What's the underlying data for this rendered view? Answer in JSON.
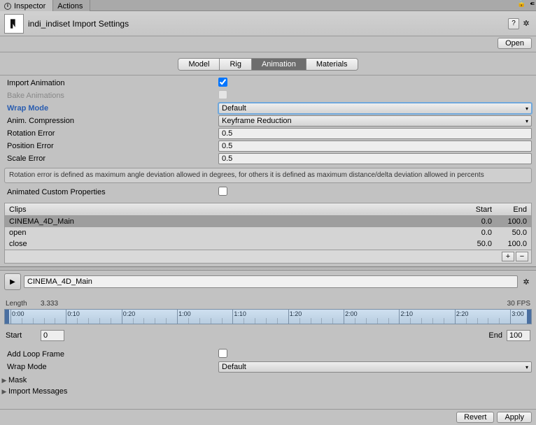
{
  "top": {
    "inspector": "Inspector",
    "actions": "Actions"
  },
  "asset": {
    "title": "indi_indiset Import Settings",
    "open": "Open"
  },
  "tabs": {
    "model": "Model",
    "rig": "Rig",
    "animation": "Animation",
    "materials": "Materials"
  },
  "labels": {
    "importAnim": "Import Animation",
    "bakeAnim": "Bake Animations",
    "wrapMode": "Wrap Mode",
    "animComp": "Anim. Compression",
    "rotErr": "Rotation Error",
    "posErr": "Position Error",
    "scaleErr": "Scale Error",
    "animCustom": "Animated Custom Properties",
    "clips": "Clips",
    "start": "Start",
    "end": "End",
    "length": "Length",
    "fps": "30 FPS",
    "startL": "Start",
    "endL": "End",
    "addLoop": "Add Loop Frame",
    "wrap2": "Wrap Mode",
    "mask": "Mask",
    "importMsg": "Import Messages",
    "revert": "Revert",
    "apply": "Apply"
  },
  "values": {
    "wrapMode": "Default",
    "animComp": "Keyframe Reduction",
    "rotErr": "0.5",
    "posErr": "0.5",
    "scaleErr": "0.5",
    "infoText": "Rotation error is defined as maximum angle deviation allowed in degrees, for others it is defined as maximum distance/delta deviation allowed in percents",
    "selectedClip": "CINEMA_4D_Main",
    "length": "3.333",
    "startVal": "0",
    "endVal": "100",
    "wrap2": "Default"
  },
  "clips": [
    {
      "name": "CINEMA_4D_Main",
      "start": "0.0",
      "end": "100.0"
    },
    {
      "name": "open",
      "start": "0.0",
      "end": "50.0"
    },
    {
      "name": "close",
      "start": "50.0",
      "end": "100.0"
    }
  ],
  "timeline": {
    "ticks": [
      "0:00",
      "0:10",
      "0:20",
      "1:00",
      "1:10",
      "1:20",
      "2:00",
      "2:10",
      "2:20",
      "3:00"
    ]
  }
}
